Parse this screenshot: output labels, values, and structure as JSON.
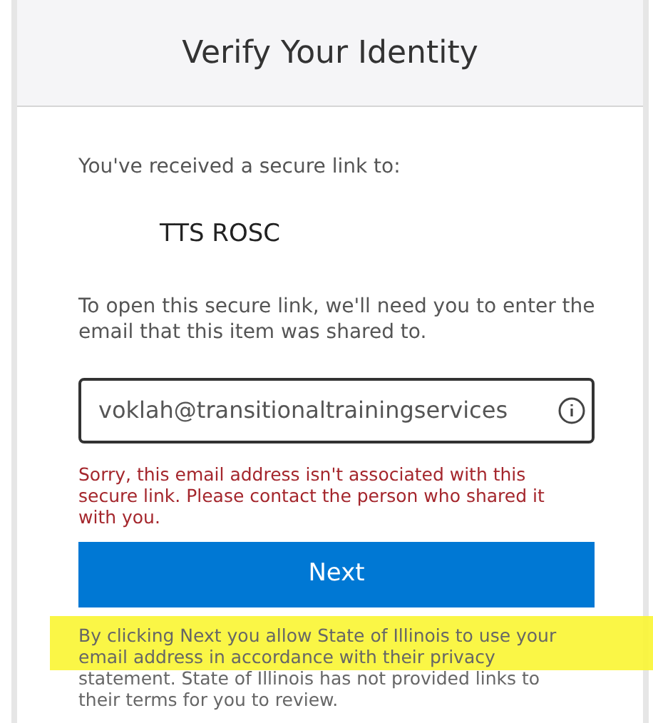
{
  "header": {
    "title": "Verify Your Identity"
  },
  "intro": "You've received a secure link to:",
  "item_name": "TTS ROSC",
  "instructions": "To open this secure link, we'll need you to enter the email that this item was shared to.",
  "email_field": {
    "value": "voklah@transitionaltrainingservices"
  },
  "error": "Sorry, this email address isn't associated with this secure link. Please contact the person who shared it with you.",
  "buttons": [
    {
      "label": "Next"
    }
  ],
  "disclaimer": {
    "text": "By clicking Next you allow State of Illinois to use your email address in accordance with their privacy statement. State of Illinois has not provided links to their terms for you to review.",
    "highlighted": true
  }
}
